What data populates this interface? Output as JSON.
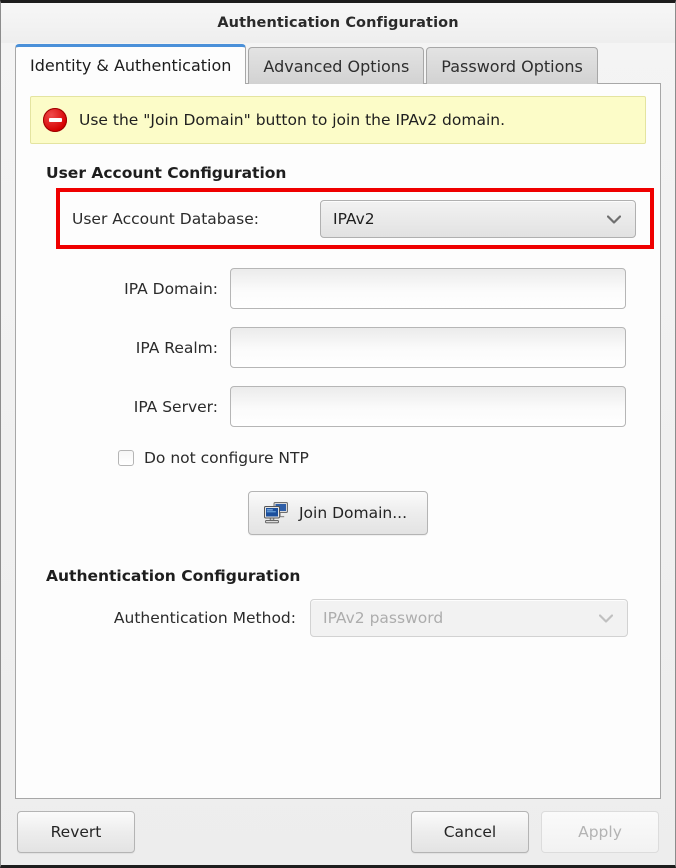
{
  "window": {
    "title": "Authentication Configuration"
  },
  "tabs": [
    {
      "label": "Identity & Authentication",
      "active": true
    },
    {
      "label": "Advanced Options",
      "active": false
    },
    {
      "label": "Password Options",
      "active": false
    }
  ],
  "infobar": {
    "icon": "no-entry-icon",
    "message": "Use the \"Join Domain\" button to join the IPAv2 domain."
  },
  "user_account_section": {
    "title": "User Account Configuration",
    "database_label": "User Account Database:",
    "database_value": "IPAv2",
    "highlight_color": "#ef0000",
    "fields": [
      {
        "label": "IPA Domain:",
        "value": "",
        "placeholder": ""
      },
      {
        "label": "IPA Realm:",
        "value": "",
        "placeholder": ""
      },
      {
        "label": "IPA Server:",
        "value": "",
        "placeholder": ""
      }
    ],
    "checkbox": {
      "label": "Do not configure NTP",
      "checked": false
    },
    "join_button": {
      "label": "Join Domain...",
      "icon": "network-computers-icon"
    }
  },
  "auth_section": {
    "title": "Authentication Configuration",
    "method_label": "Authentication Method:",
    "method_value": "IPAv2 password",
    "method_disabled": true
  },
  "actions": {
    "revert": "Revert",
    "cancel": "Cancel",
    "apply": "Apply",
    "apply_disabled": true
  },
  "colors": {
    "accent": "#4a90d9",
    "warning_bg": "#fcfcc8",
    "highlight": "#ef0000",
    "error_icon": "#d50000"
  }
}
